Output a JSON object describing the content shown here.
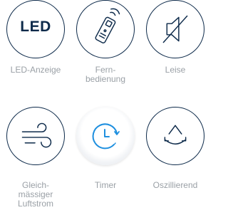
{
  "features": [
    {
      "icon": "led-text-icon",
      "icon_text": "LED",
      "label": "LED-Anzeige"
    },
    {
      "icon": "remote-control-icon",
      "label": "Fern-\nbedienung"
    },
    {
      "icon": "mute-speaker-icon",
      "label": "Leise"
    },
    {
      "icon": "airflow-wind-icon",
      "label": "Gleich-\nmässiger\nLuftstrom"
    },
    {
      "icon": "timer-clock-icon",
      "label": "Timer"
    },
    {
      "icon": "oscillation-icon",
      "label": "Oszillierend"
    }
  ],
  "colors": {
    "icon_stroke": "#0d2a4a",
    "accent_blue": "#1e8fdf",
    "label_gray": "#9aa0a6"
  }
}
